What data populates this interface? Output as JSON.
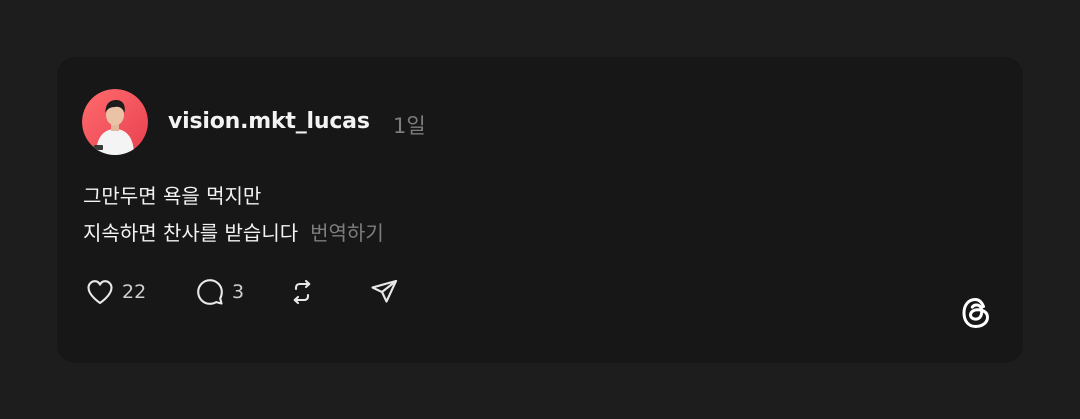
{
  "post": {
    "username": "vision.mkt_lucas",
    "timestamp": "1일",
    "text_line1": "그만두면 욕을 먹지만",
    "text_line2": "지속하면 찬사를 받습니다",
    "translate_label": "번역하기",
    "avatar_alt": "vision.mkt_lucas profile picture"
  },
  "actions": {
    "like_icon": "heart-icon",
    "like_count": "22",
    "reply_icon": "speech-bubble-icon",
    "reply_count": "3",
    "repost_icon": "repost-icon",
    "share_icon": "paper-plane-icon"
  },
  "brand": {
    "logo": "threads-logo",
    "background": "#1d1d1d",
    "card_color": "#171717",
    "text_color": "#f3f3f3",
    "muted_color": "#7d7d7d",
    "avatar_bg": "#f0505d"
  }
}
